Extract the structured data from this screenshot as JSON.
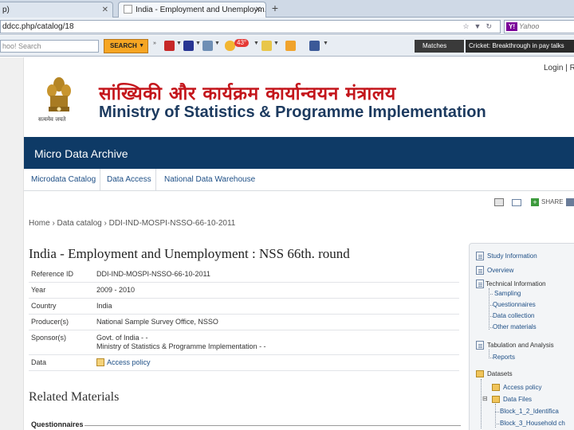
{
  "browser": {
    "tabs": [
      {
        "label": "p)"
      },
      {
        "label": "India - Employment and Unemploym..."
      }
    ],
    "new_tab": "+",
    "url": "ddcc.php/catalog/18",
    "search_engine_placeholder": "Yahoo",
    "toolbar": {
      "search_placeholder": "hoo! Search",
      "search_button": "SEARCH",
      "weather_badge": "43°",
      "matches_label": "Matches",
      "news_ticker": "Cricket: Breakthrough in pay talks"
    }
  },
  "page": {
    "top_links": "Login | R",
    "banner": {
      "hindi_title": "सांख्यिकी और कार्यक्रम कार्यान्वयन मंत्रालय",
      "english_title": "Ministry of Statistics & Programme Implementation",
      "emblem_motto": "सत्यमेव जयते"
    },
    "archive_title": "Micro Data Archive",
    "nav": [
      {
        "label": "Microdata Catalog"
      },
      {
        "label": "Data Access"
      },
      {
        "label": "National Data Warehouse"
      }
    ],
    "share_label": "SHARE",
    "breadcrumb": "Home › Data catalog › DDI-IND-MOSPI-NSSO-66-10-2011",
    "study_title": "India - Employment and Unemployment : NSS 66th. round",
    "info_rows": {
      "reference_id": {
        "label": "Reference ID",
        "value": "DDI-IND-MOSPI-NSSO-66-10-2011"
      },
      "year": {
        "label": "Year",
        "value": "2009 - 2010"
      },
      "country": {
        "label": "Country",
        "value": "India"
      },
      "producer": {
        "label": "Producer(s)",
        "value": "National Sample Survey Office, NSSO"
      },
      "sponsor": {
        "label": "Sponsor(s)",
        "value_line1": "Govt. of India - -",
        "value_line2": "Ministry of Statistics & Programme Implementation - -"
      },
      "data": {
        "label": "Data",
        "value": "Access policy"
      }
    },
    "related_title": "Related Materials",
    "questionnaires_label": "Questionnaires",
    "side_tree": {
      "study_information": "Study Information",
      "overview": "Overview",
      "technical_information": "Technical Information",
      "sampling": "Sampling",
      "questionnaires": "Questionnaires",
      "data_collection": "Data collection",
      "other_materials": "Other materials",
      "tabulation": "Tabulation and Analysis",
      "reports": "Reports",
      "datasets": "Datasets",
      "access_policy": "Access policy",
      "data_files": "Data Files",
      "block_1": "Block_1_2_Identifica",
      "block_3": "Block_3_Household ch"
    }
  }
}
